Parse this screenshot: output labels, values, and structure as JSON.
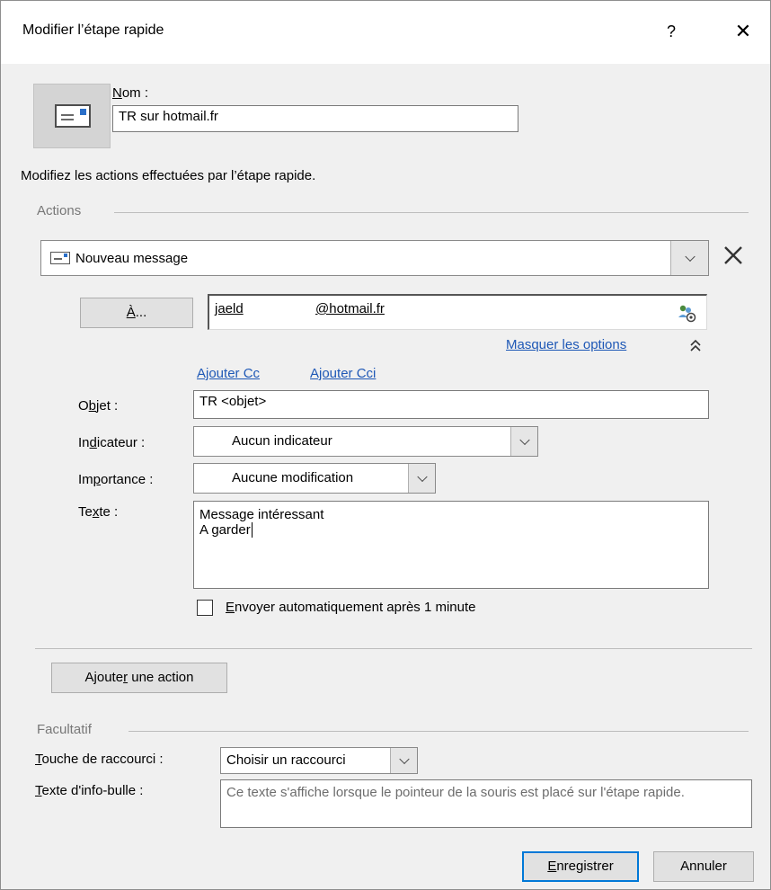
{
  "window": {
    "title": "Modifier l’étape rapide",
    "help_glyph": "?",
    "close_glyph": "✕"
  },
  "name_field": {
    "label_first": "N",
    "label_rest": "om :",
    "value": "TR sur hotmail.fr",
    "icon": "quick-step-envelope-icon"
  },
  "instruction": "Modifiez les actions effectuées par l’étape rapide.",
  "actions_group": {
    "label": "Actions",
    "action_select": {
      "icon": "new-message-icon",
      "value": "Nouveau message"
    },
    "remove_glyph": "✕"
  },
  "to_row": {
    "button_first": "À",
    "button_rest": "...",
    "recipient_start": "jaeld",
    "recipient_domain": "@hotmail.fr",
    "address_book_icon": "address-book-icon"
  },
  "options": {
    "hide_options": "Masquer les options",
    "collapse_glyph": "≈",
    "add_cc": "Ajouter Cc",
    "add_bcc": "Ajouter Cci"
  },
  "fields": {
    "subject": {
      "label_a": "O",
      "label_u": "b",
      "label_b": "jet :",
      "value": "TR <objet>"
    },
    "flag": {
      "label_a": "In",
      "label_u": "d",
      "label_b": "icateur :",
      "value": "Aucun indicateur"
    },
    "importance": {
      "label_a": "Im",
      "label_u": "p",
      "label_b": "ortance :",
      "value": "Aucune modification"
    },
    "text": {
      "label_a": "Te",
      "label_u": "x",
      "label_b": "te :",
      "line1": "Message intéressant",
      "line2": "A garder"
    }
  },
  "auto_send": {
    "label_u": "E",
    "label_rest": "nvoyer automatiquement après 1 minute",
    "checked": false
  },
  "add_action": {
    "label_a": "Ajoute",
    "label_u": "r",
    "label_b": " une action"
  },
  "optional_group": {
    "label": "Facultatif",
    "shortcut": {
      "label_u": "T",
      "label_rest": "ouche de raccourci :",
      "value": "Choisir un raccourci"
    },
    "tooltip": {
      "label_u": "T",
      "label_rest": "exte d'info-bulle :",
      "value": "Ce texte s'affiche lorsque le pointeur de la souris est placé sur l'étape rapide."
    }
  },
  "footer": {
    "save_u": "E",
    "save_rest": "nregistrer",
    "cancel": "Annuler"
  },
  "colors": {
    "link": "#1e58b6",
    "accent": "#0078d7",
    "client_bg": "#f0f0f0"
  }
}
